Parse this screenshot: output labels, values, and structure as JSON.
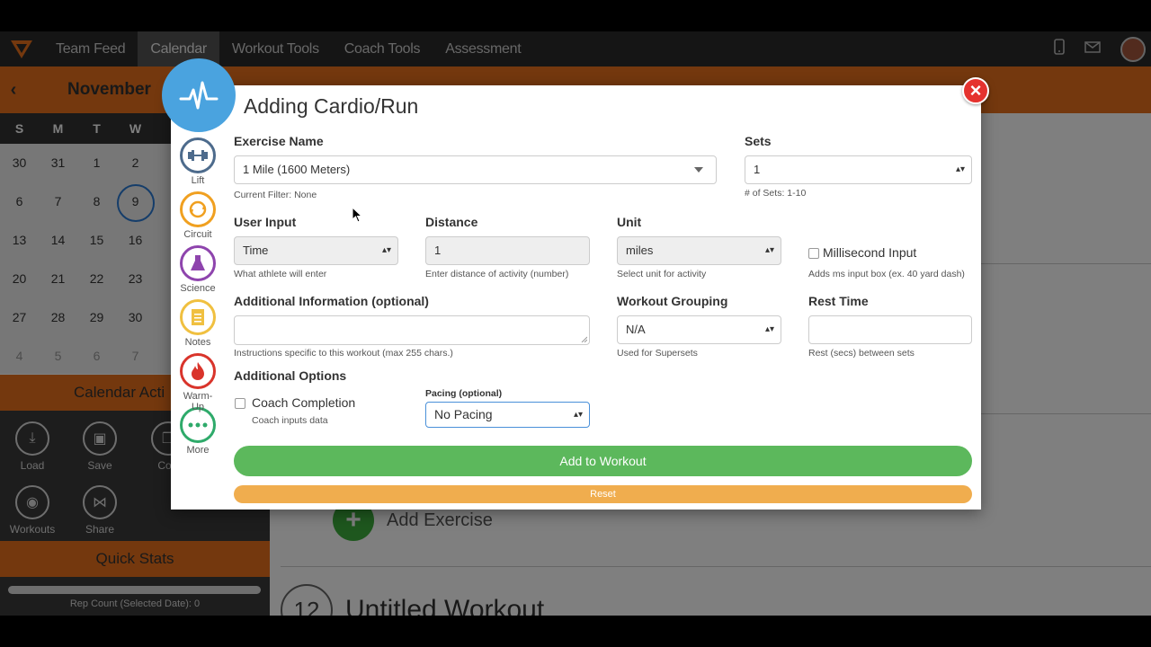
{
  "nav": {
    "items": [
      "Team Feed",
      "Calendar",
      "Workout Tools",
      "Coach Tools",
      "Assessment"
    ],
    "active": "Calendar",
    "brand_color": "#e8711c"
  },
  "calendar": {
    "month": "November",
    "days_of_week": [
      "S",
      "M",
      "T",
      "W"
    ],
    "weeks": [
      [
        "30",
        "31",
        "1",
        "2"
      ],
      [
        "6",
        "7",
        "8",
        "9"
      ],
      [
        "13",
        "14",
        "15",
        "16"
      ],
      [
        "20",
        "21",
        "22",
        "23"
      ],
      [
        "27",
        "28",
        "29",
        "30"
      ],
      [
        "4",
        "5",
        "6",
        "7"
      ]
    ],
    "today": "9",
    "actions_title": "Calendar Acti",
    "actions": [
      "Load",
      "Save",
      "Co",
      "Workouts",
      "Share"
    ],
    "quick_stats_title": "Quick Stats",
    "rep_count": "Rep Count (Selected Date): 0"
  },
  "main": {
    "add_exercise": "Add Exercise",
    "workout_number": "12",
    "workout_title": "Untitled Workout"
  },
  "modal": {
    "title": "Adding Cardio/Run",
    "close_label": "×",
    "side_tabs": [
      {
        "label": "Lift",
        "icon": "dumbbell-icon",
        "color": "#4d6b8c"
      },
      {
        "label": "Circuit",
        "icon": "circuit-icon",
        "color": "#f0a020"
      },
      {
        "label": "Science",
        "icon": "flask-icon",
        "color": "#8e44ad"
      },
      {
        "label": "Notes",
        "icon": "notes-icon",
        "color": "#f0c040"
      },
      {
        "label": "Warm-Up",
        "icon": "flame-icon",
        "color": "#d9342b"
      },
      {
        "label": "More",
        "icon": "more-icon",
        "color": "#2eaa6a"
      }
    ],
    "exercise_name": {
      "label": "Exercise Name",
      "value": "1 Mile (1600 Meters)",
      "help": "Current Filter: None"
    },
    "sets": {
      "label": "Sets",
      "value": "1",
      "help": "# of Sets: 1-10"
    },
    "user_input": {
      "label": "User Input",
      "value": "Time",
      "help": "What athlete will enter"
    },
    "distance": {
      "label": "Distance",
      "value": "1",
      "help": "Enter distance of activity (number)"
    },
    "unit": {
      "label": "Unit",
      "value": "miles",
      "help": "Select unit for activity"
    },
    "millisecond": {
      "label": "Millisecond Input",
      "help": "Adds ms input box (ex. 40 yard dash)"
    },
    "additional_info": {
      "label": "Additional Information (optional)",
      "value": "",
      "help": "Instructions specific to this workout (max 255 chars.)"
    },
    "workout_grouping": {
      "label": "Workout Grouping",
      "value": "N/A",
      "help": "Used for Supersets"
    },
    "rest_time": {
      "label": "Rest Time",
      "value": "",
      "help": "Rest (secs) between sets"
    },
    "additional_options": {
      "label": "Additional Options"
    },
    "coach_completion": {
      "label": "Coach Completion",
      "help": "Coach inputs data"
    },
    "pacing": {
      "label": "Pacing (optional)",
      "value": "No Pacing"
    },
    "add_button": "Add to Workout",
    "reset_button": "Reset",
    "colors": {
      "add": "#5cb85c",
      "reset": "#f0ad4e",
      "close": "#e5322e",
      "badge": "#4aa3df"
    }
  }
}
